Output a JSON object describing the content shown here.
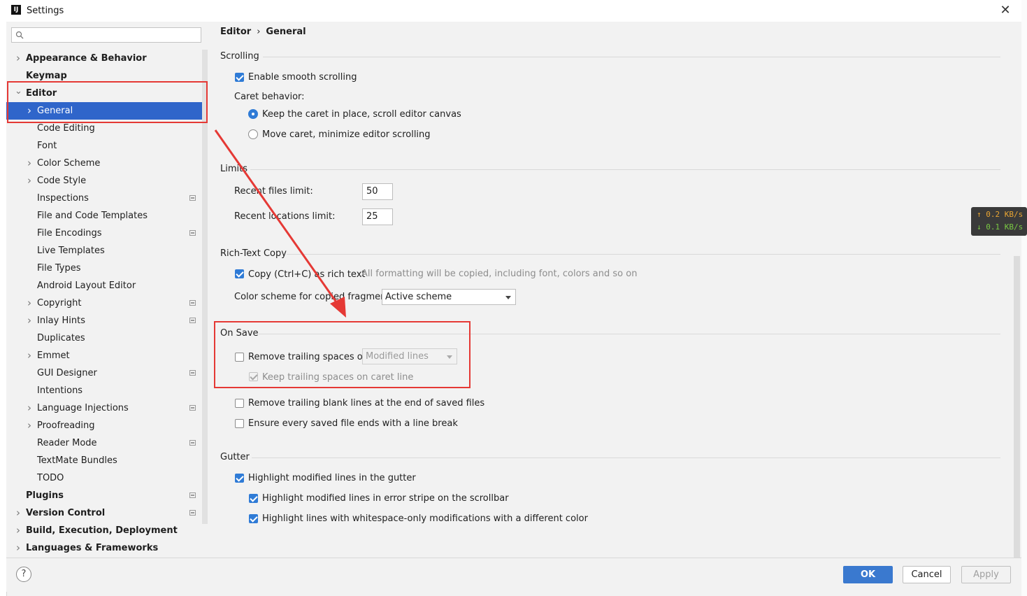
{
  "window": {
    "title": "Settings",
    "logo": "IJ"
  },
  "search": {
    "placeholder": ""
  },
  "tree": [
    {
      "label": "Appearance & Behavior",
      "level": 0,
      "arrow": "right"
    },
    {
      "label": "Keymap",
      "level": 0,
      "arrow": ""
    },
    {
      "label": "Editor",
      "level": 0,
      "arrow": "down"
    },
    {
      "label": "General",
      "level": 1,
      "arrow": "right",
      "selected": true
    },
    {
      "label": "Code Editing",
      "level": 1,
      "arrow": ""
    },
    {
      "label": "Font",
      "level": 1,
      "arrow": ""
    },
    {
      "label": "Color Scheme",
      "level": 1,
      "arrow": "right"
    },
    {
      "label": "Code Style",
      "level": 1,
      "arrow": "right"
    },
    {
      "label": "Inspections",
      "level": 1,
      "arrow": "",
      "project_icon": true
    },
    {
      "label": "File and Code Templates",
      "level": 1,
      "arrow": ""
    },
    {
      "label": "File Encodings",
      "level": 1,
      "arrow": "",
      "project_icon": true
    },
    {
      "label": "Live Templates",
      "level": 1,
      "arrow": ""
    },
    {
      "label": "File Types",
      "level": 1,
      "arrow": ""
    },
    {
      "label": "Android Layout Editor",
      "level": 1,
      "arrow": ""
    },
    {
      "label": "Copyright",
      "level": 1,
      "arrow": "right",
      "project_icon": true
    },
    {
      "label": "Inlay Hints",
      "level": 1,
      "arrow": "right",
      "project_icon": true
    },
    {
      "label": "Duplicates",
      "level": 1,
      "arrow": ""
    },
    {
      "label": "Emmet",
      "level": 1,
      "arrow": "right"
    },
    {
      "label": "GUI Designer",
      "level": 1,
      "arrow": "",
      "project_icon": true
    },
    {
      "label": "Intentions",
      "level": 1,
      "arrow": ""
    },
    {
      "label": "Language Injections",
      "level": 1,
      "arrow": "right",
      "project_icon": true
    },
    {
      "label": "Proofreading",
      "level": 1,
      "arrow": "right"
    },
    {
      "label": "Reader Mode",
      "level": 1,
      "arrow": "",
      "project_icon": true
    },
    {
      "label": "TextMate Bundles",
      "level": 1,
      "arrow": ""
    },
    {
      "label": "TODO",
      "level": 1,
      "arrow": ""
    },
    {
      "label": "Plugins",
      "level": 0,
      "arrow": "",
      "project_icon": true
    },
    {
      "label": "Version Control",
      "level": 0,
      "arrow": "right",
      "project_icon": true
    },
    {
      "label": "Build, Execution, Deployment",
      "level": 0,
      "arrow": "right"
    },
    {
      "label": "Languages & Frameworks",
      "level": 0,
      "arrow": "right"
    }
  ],
  "breadcrumb": {
    "parent": "Editor",
    "separator": "›",
    "current": "General"
  },
  "scrolling": {
    "title": "Scrolling",
    "smooth_label": "Enable smooth scrolling",
    "caret_label": "Caret behavior:",
    "caret_option1": "Keep the caret in place, scroll editor canvas",
    "caret_option2": "Move caret, minimize editor scrolling"
  },
  "limits": {
    "title": "Limits",
    "recent_files_label": "Recent files limit:",
    "recent_files_value": "50",
    "recent_locations_label": "Recent locations limit:",
    "recent_locations_value": "25"
  },
  "rich_text": {
    "title": "Rich-Text Copy",
    "copy_label": "Copy (Ctrl+C) as rich text",
    "copy_hint": "All formatting will be copied, including font, colors and so on",
    "scheme_label": "Color scheme for copied fragment:",
    "scheme_value": "Active scheme"
  },
  "on_save": {
    "title": "On Save",
    "remove_trailing_label": "Remove trailing spaces on:",
    "remove_trailing_value": "Modified lines",
    "keep_caret_label": "Keep trailing spaces on caret line",
    "remove_blank_label": "Remove trailing blank lines at the end of saved files",
    "ensure_break_label": "Ensure every saved file ends with a line break"
  },
  "gutter": {
    "title": "Gutter",
    "highlight_modified_label": "Highlight modified lines in the gutter",
    "highlight_stripe_label": "Highlight modified lines in error stripe on the scrollbar",
    "highlight_whitespace_label": "Highlight lines with whitespace-only modifications with a different color"
  },
  "footer": {
    "help": "?",
    "ok": "OK",
    "cancel": "Cancel",
    "apply": "Apply"
  },
  "network_overlay": {
    "up": "↑ 0.2 KB/s",
    "down": "↓ 0.1 KB/s"
  },
  "colors": {
    "accent": "#2f65ca",
    "annotation": "#e53935"
  }
}
